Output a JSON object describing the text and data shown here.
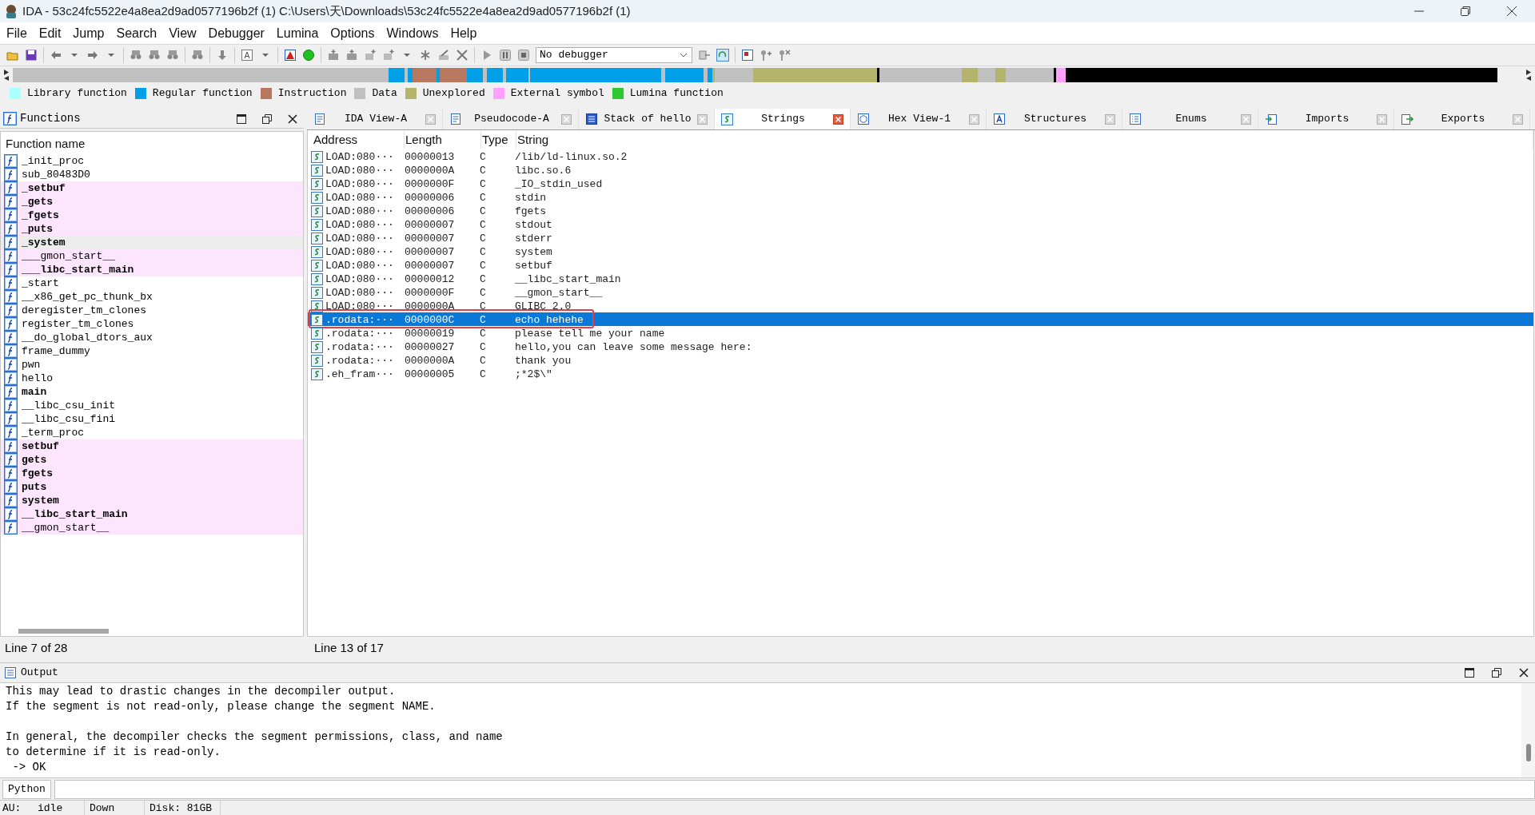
{
  "window": {
    "title": "IDA - 53c24fc5522e4a8ea2d9ad0577196b2f (1) C:\\Users\\天\\Downloads\\53c24fc5522e4a8ea2d9ad0577196b2f (1)"
  },
  "menu": [
    "File",
    "Edit",
    "Jump",
    "Search",
    "View",
    "Debugger",
    "Lumina",
    "Options",
    "Windows",
    "Help"
  ],
  "toolbar": {
    "debugger": "No debugger"
  },
  "legend": [
    {
      "label": "Library function",
      "color": "#aaffff"
    },
    {
      "label": "Regular function",
      "color": "#00a0e8"
    },
    {
      "label": "Instruction",
      "color": "#b87860"
    },
    {
      "label": "Data",
      "color": "#c0c0c0"
    },
    {
      "label": "Unexplored",
      "color": "#b4b46c"
    },
    {
      "label": "External symbol",
      "color": "#ffa0ff"
    },
    {
      "label": "Lumina function",
      "color": "#30c830"
    }
  ],
  "functions": {
    "title": "Functions",
    "column": "Function name",
    "status": "Line 7 of 28",
    "items": [
      {
        "name": "_init_proc",
        "bold": false,
        "external": false,
        "selected": false
      },
      {
        "name": "sub_80483D0",
        "bold": false,
        "external": false,
        "selected": false
      },
      {
        "name": "_setbuf",
        "bold": true,
        "external": true,
        "selected": false
      },
      {
        "name": "_gets",
        "bold": true,
        "external": true,
        "selected": false
      },
      {
        "name": "_fgets",
        "bold": true,
        "external": true,
        "selected": false
      },
      {
        "name": "_puts",
        "bold": true,
        "external": true,
        "selected": false
      },
      {
        "name": "_system",
        "bold": true,
        "external": true,
        "selected": true
      },
      {
        "name": "___gmon_start__",
        "bold": false,
        "external": true,
        "selected": false
      },
      {
        "name": "___libc_start_main",
        "bold": true,
        "external": true,
        "selected": false
      },
      {
        "name": "_start",
        "bold": false,
        "external": false,
        "selected": false
      },
      {
        "name": "__x86_get_pc_thunk_bx",
        "bold": false,
        "external": false,
        "selected": false
      },
      {
        "name": "deregister_tm_clones",
        "bold": false,
        "external": false,
        "selected": false
      },
      {
        "name": "register_tm_clones",
        "bold": false,
        "external": false,
        "selected": false
      },
      {
        "name": "__do_global_dtors_aux",
        "bold": false,
        "external": false,
        "selected": false
      },
      {
        "name": "frame_dummy",
        "bold": false,
        "external": false,
        "selected": false
      },
      {
        "name": "pwn",
        "bold": false,
        "external": false,
        "selected": false
      },
      {
        "name": "hello",
        "bold": false,
        "external": false,
        "selected": false
      },
      {
        "name": "main",
        "bold": true,
        "external": false,
        "selected": false
      },
      {
        "name": "__libc_csu_init",
        "bold": false,
        "external": false,
        "selected": false
      },
      {
        "name": "__libc_csu_fini",
        "bold": false,
        "external": false,
        "selected": false
      },
      {
        "name": "_term_proc",
        "bold": false,
        "external": false,
        "selected": false
      },
      {
        "name": "setbuf",
        "bold": true,
        "external": true,
        "selected": false
      },
      {
        "name": "gets",
        "bold": true,
        "external": true,
        "selected": false
      },
      {
        "name": "fgets",
        "bold": true,
        "external": true,
        "selected": false
      },
      {
        "name": "puts",
        "bold": true,
        "external": true,
        "selected": false
      },
      {
        "name": "system",
        "bold": true,
        "external": true,
        "selected": false
      },
      {
        "name": "__libc_start_main",
        "bold": true,
        "external": true,
        "selected": false
      },
      {
        "name": "__gmon_start__",
        "bold": false,
        "external": true,
        "selected": false
      }
    ]
  },
  "tabs": [
    {
      "label": "IDA View-A",
      "kind": "disasm",
      "selected": false
    },
    {
      "label": "Pseudocode-A",
      "kind": "disasm",
      "selected": false
    },
    {
      "label": "Stack of hello",
      "kind": "stack",
      "selected": false
    },
    {
      "label": "Strings",
      "kind": "strings",
      "selected": true
    },
    {
      "label": "Hex View-1",
      "kind": "hex",
      "selected": false
    },
    {
      "label": "Structures",
      "kind": "struct",
      "selected": false
    },
    {
      "label": "Enums",
      "kind": "enum",
      "selected": false
    },
    {
      "label": "Imports",
      "kind": "imports",
      "selected": false
    },
    {
      "label": "Exports",
      "kind": "exports",
      "selected": false
    }
  ],
  "strings": {
    "columns": [
      "Address",
      "Length",
      "Type",
      "String"
    ],
    "status": "Line 13 of 17",
    "rows": [
      {
        "address": "LOAD:080···",
        "length": "00000013",
        "type": "C",
        "string": "/lib/ld-linux.so.2",
        "selected": false,
        "boxed": false
      },
      {
        "address": "LOAD:080···",
        "length": "0000000A",
        "type": "C",
        "string": "libc.so.6",
        "selected": false,
        "boxed": false
      },
      {
        "address": "LOAD:080···",
        "length": "0000000F",
        "type": "C",
        "string": "_IO_stdin_used",
        "selected": false,
        "boxed": false
      },
      {
        "address": "LOAD:080···",
        "length": "00000006",
        "type": "C",
        "string": "stdin",
        "selected": false,
        "boxed": false
      },
      {
        "address": "LOAD:080···",
        "length": "00000006",
        "type": "C",
        "string": "fgets",
        "selected": false,
        "boxed": false
      },
      {
        "address": "LOAD:080···",
        "length": "00000007",
        "type": "C",
        "string": "stdout",
        "selected": false,
        "boxed": false
      },
      {
        "address": "LOAD:080···",
        "length": "00000007",
        "type": "C",
        "string": "stderr",
        "selected": false,
        "boxed": false
      },
      {
        "address": "LOAD:080···",
        "length": "00000007",
        "type": "C",
        "string": "system",
        "selected": false,
        "boxed": false
      },
      {
        "address": "LOAD:080···",
        "length": "00000007",
        "type": "C",
        "string": "setbuf",
        "selected": false,
        "boxed": false
      },
      {
        "address": "LOAD:080···",
        "length": "00000012",
        "type": "C",
        "string": "__libc_start_main",
        "selected": false,
        "boxed": false
      },
      {
        "address": "LOAD:080···",
        "length": "0000000F",
        "type": "C",
        "string": "__gmon_start__",
        "selected": false,
        "boxed": false
      },
      {
        "address": "LOAD:080···",
        "length": "0000000A",
        "type": "C",
        "string": "GLIBC_2.0",
        "selected": false,
        "boxed": false
      },
      {
        "address": ".rodata:···",
        "length": "0000000C",
        "type": "C",
        "string": "echo hehehe",
        "selected": true,
        "boxed": true
      },
      {
        "address": ".rodata:···",
        "length": "00000019",
        "type": "C",
        "string": "please tell me your name",
        "selected": false,
        "boxed": false
      },
      {
        "address": ".rodata:···",
        "length": "00000027",
        "type": "C",
        "string": "hello,you can leave some message here:",
        "selected": false,
        "boxed": false
      },
      {
        "address": ".rodata:···",
        "length": "0000000A",
        "type": "C",
        "string": "thank you",
        "selected": false,
        "boxed": false
      },
      {
        "address": ".eh_fram···",
        "length": "00000005",
        "type": "C",
        "string": ";*2$\\\"",
        "selected": false,
        "boxed": false
      }
    ]
  },
  "output": {
    "title": "Output",
    "paragraphs": [
      [
        "This may lead to drastic changes in the decompiler output.",
        "If the segment is not read-only, please change the segment NAME."
      ],
      [
        "In general, the decompiler checks the segment permissions, class, and name",
        "to determine if it is read-only.",
        " -> OK"
      ]
    ],
    "language": "Python"
  },
  "status_bar": [
    "AU:",
    "idle",
    "Down",
    "Disk: 81GB"
  ]
}
